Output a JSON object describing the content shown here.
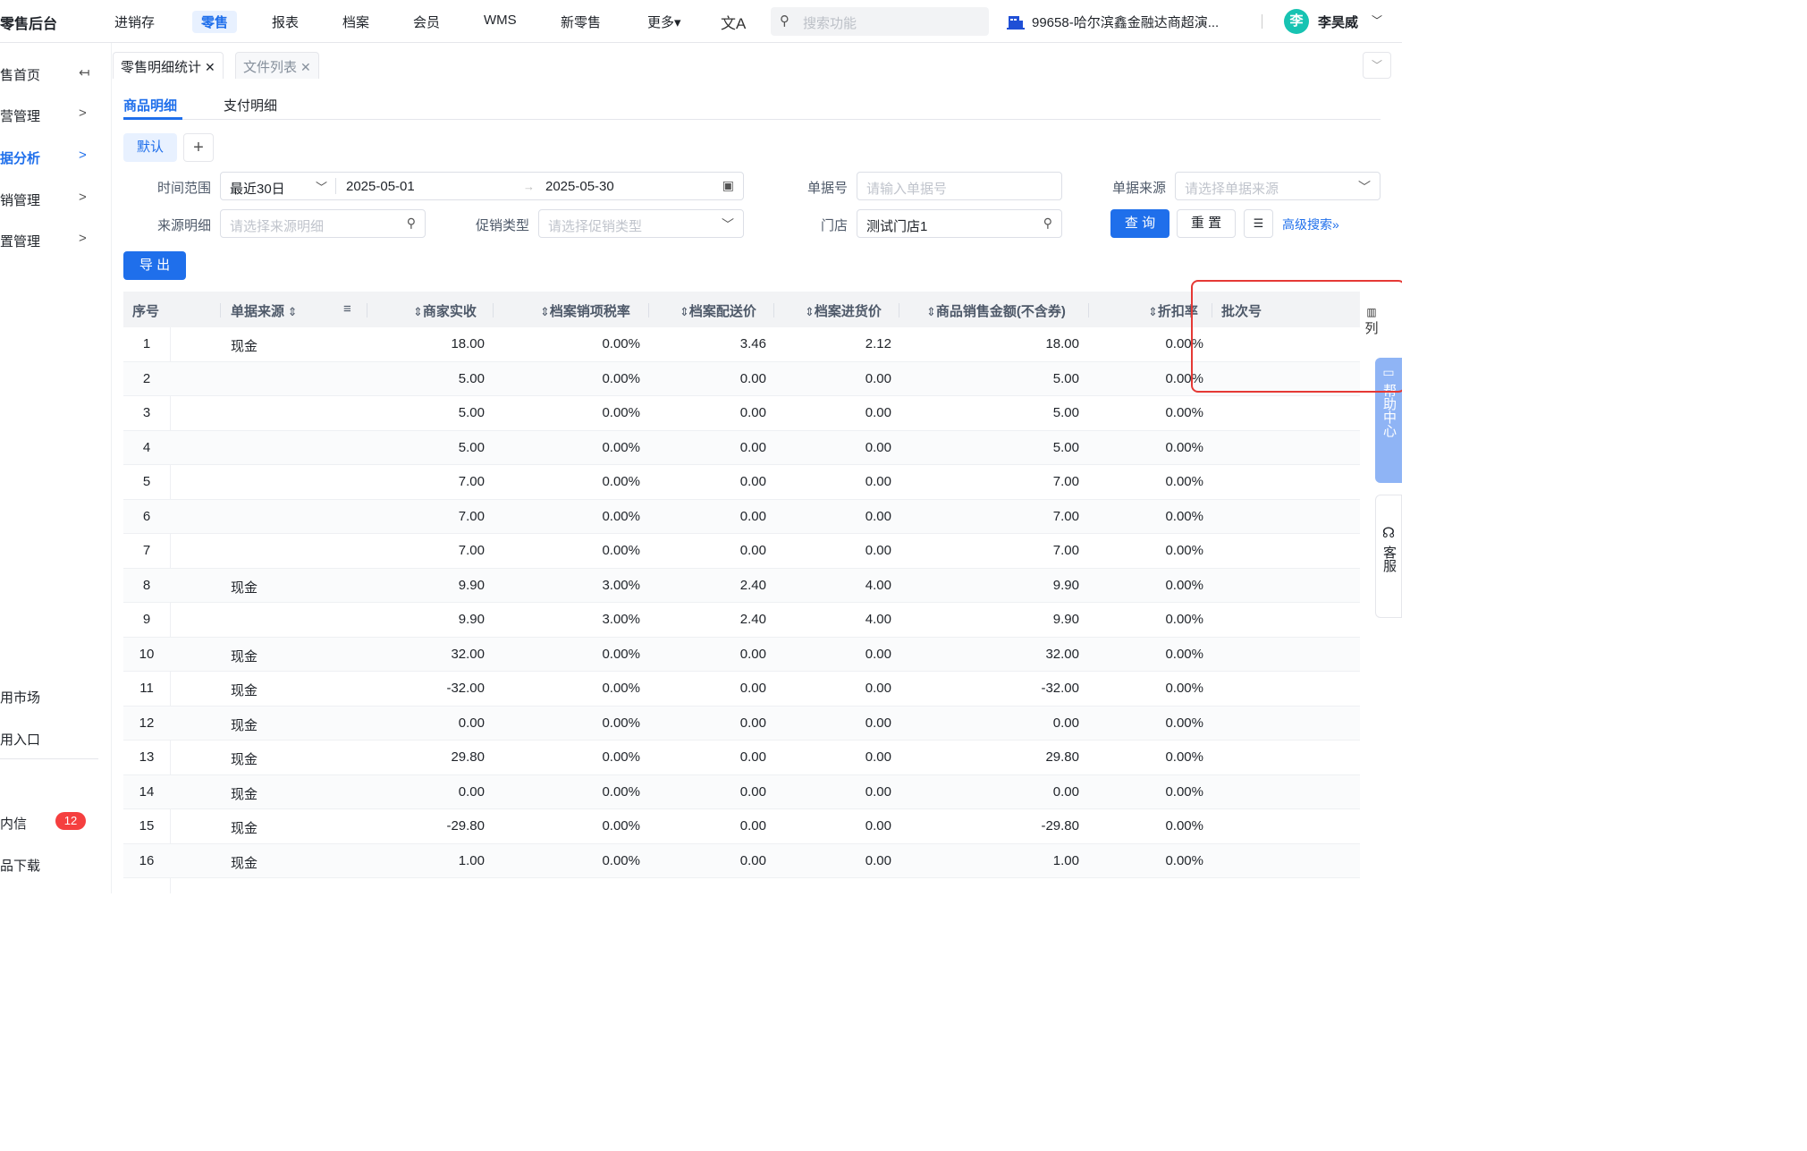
{
  "topbar": {
    "brand": "零售后台",
    "nav": [
      "进销存",
      "零售",
      "报表",
      "档案",
      "会员",
      "WMS",
      "新零售",
      "更多▾"
    ],
    "active_nav": "零售",
    "translate_icon": "translate-icon",
    "search_placeholder": "搜索功能",
    "store_name": "99658-哈尔滨鑫金融达商超演...",
    "avatar_initial": "李",
    "user_name": "李昊威"
  },
  "sidebar": {
    "items": [
      {
        "label": "售首页",
        "arrow": "↤"
      },
      {
        "label": "营管理",
        "arrow": ">"
      },
      {
        "label": "据分析",
        "arrow": ">"
      },
      {
        "label": "销管理",
        "arrow": ">"
      },
      {
        "label": "置管理",
        "arrow": ">"
      }
    ],
    "bottom_items": [
      "用市场",
      "用入口"
    ],
    "extra_items": [
      "内信",
      "品下载"
    ],
    "badge_count": "12"
  },
  "tabs": {
    "page_tabs": [
      "零售明细统计",
      "文件列表"
    ],
    "sub_tabs": [
      "商品明细",
      "支付明细"
    ],
    "view_chip": "默认",
    "add_view": "+"
  },
  "filters": {
    "time_range_label": "时间范围",
    "time_preset": "最近30日",
    "date_start": "2025-05-01",
    "date_end": "2025-05-30",
    "doc_no_label": "单据号",
    "doc_no_placeholder": "请输入单据号",
    "doc_source_label": "单据来源",
    "doc_source_placeholder": "请选择单据来源",
    "source_detail_label": "来源明细",
    "source_detail_placeholder": "请选择来源明细",
    "promo_type_label": "促销类型",
    "promo_type_placeholder": "请选择促销类型",
    "store_label": "门店",
    "store_value": "测试门店1",
    "query_button": "查 询",
    "reset_button": "重 置",
    "advanced_search": "高级搜索»"
  },
  "actions": {
    "export_button": "导 出"
  },
  "table": {
    "columns": [
      "序号",
      "单据来源",
      "商家实收",
      "档案销项税率",
      "档案配送价",
      "档案进货价",
      "商品销售金额(不含券)",
      "折扣率",
      "批次号"
    ],
    "rows": [
      [
        "1",
        "现金",
        "18.00",
        "0.00%",
        "3.46",
        "2.12",
        "18.00",
        "0.00%",
        ""
      ],
      [
        "2",
        "",
        "5.00",
        "0.00%",
        "0.00",
        "0.00",
        "5.00",
        "0.00%",
        ""
      ],
      [
        "3",
        "",
        "5.00",
        "0.00%",
        "0.00",
        "0.00",
        "5.00",
        "0.00%",
        ""
      ],
      [
        "4",
        "",
        "5.00",
        "0.00%",
        "0.00",
        "0.00",
        "5.00",
        "0.00%",
        ""
      ],
      [
        "5",
        "",
        "7.00",
        "0.00%",
        "0.00",
        "0.00",
        "7.00",
        "0.00%",
        ""
      ],
      [
        "6",
        "",
        "7.00",
        "0.00%",
        "0.00",
        "0.00",
        "7.00",
        "0.00%",
        ""
      ],
      [
        "7",
        "",
        "7.00",
        "0.00%",
        "0.00",
        "0.00",
        "7.00",
        "0.00%",
        ""
      ],
      [
        "8",
        "现金",
        "9.90",
        "3.00%",
        "2.40",
        "4.00",
        "9.90",
        "0.00%",
        ""
      ],
      [
        "9",
        "",
        "9.90",
        "3.00%",
        "2.40",
        "4.00",
        "9.90",
        "0.00%",
        ""
      ],
      [
        "10",
        "现金",
        "32.00",
        "0.00%",
        "0.00",
        "0.00",
        "32.00",
        "0.00%",
        ""
      ],
      [
        "11",
        "现金",
        "-32.00",
        "0.00%",
        "0.00",
        "0.00",
        "-32.00",
        "0.00%",
        ""
      ],
      [
        "12",
        "现金",
        "0.00",
        "0.00%",
        "0.00",
        "0.00",
        "0.00",
        "0.00%",
        ""
      ],
      [
        "13",
        "现金",
        "29.80",
        "0.00%",
        "0.00",
        "0.00",
        "29.80",
        "0.00%",
        ""
      ],
      [
        "14",
        "现金",
        "0.00",
        "0.00%",
        "0.00",
        "0.00",
        "0.00",
        "0.00%",
        ""
      ],
      [
        "15",
        "现金",
        "-29.80",
        "0.00%",
        "0.00",
        "0.00",
        "-29.80",
        "0.00%",
        ""
      ],
      [
        "16",
        "现金",
        "1.00",
        "0.00%",
        "0.00",
        "0.00",
        "1.00",
        "0.00%",
        ""
      ]
    ]
  },
  "side_tools": {
    "column_setting": "列",
    "help_center": "帮助中心",
    "customer_service": "客服"
  },
  "colors": {
    "accent": "#1f6feb",
    "badge": "#f53f3f",
    "highlight": "#e53935",
    "help_tab": "#8fb4f5"
  }
}
